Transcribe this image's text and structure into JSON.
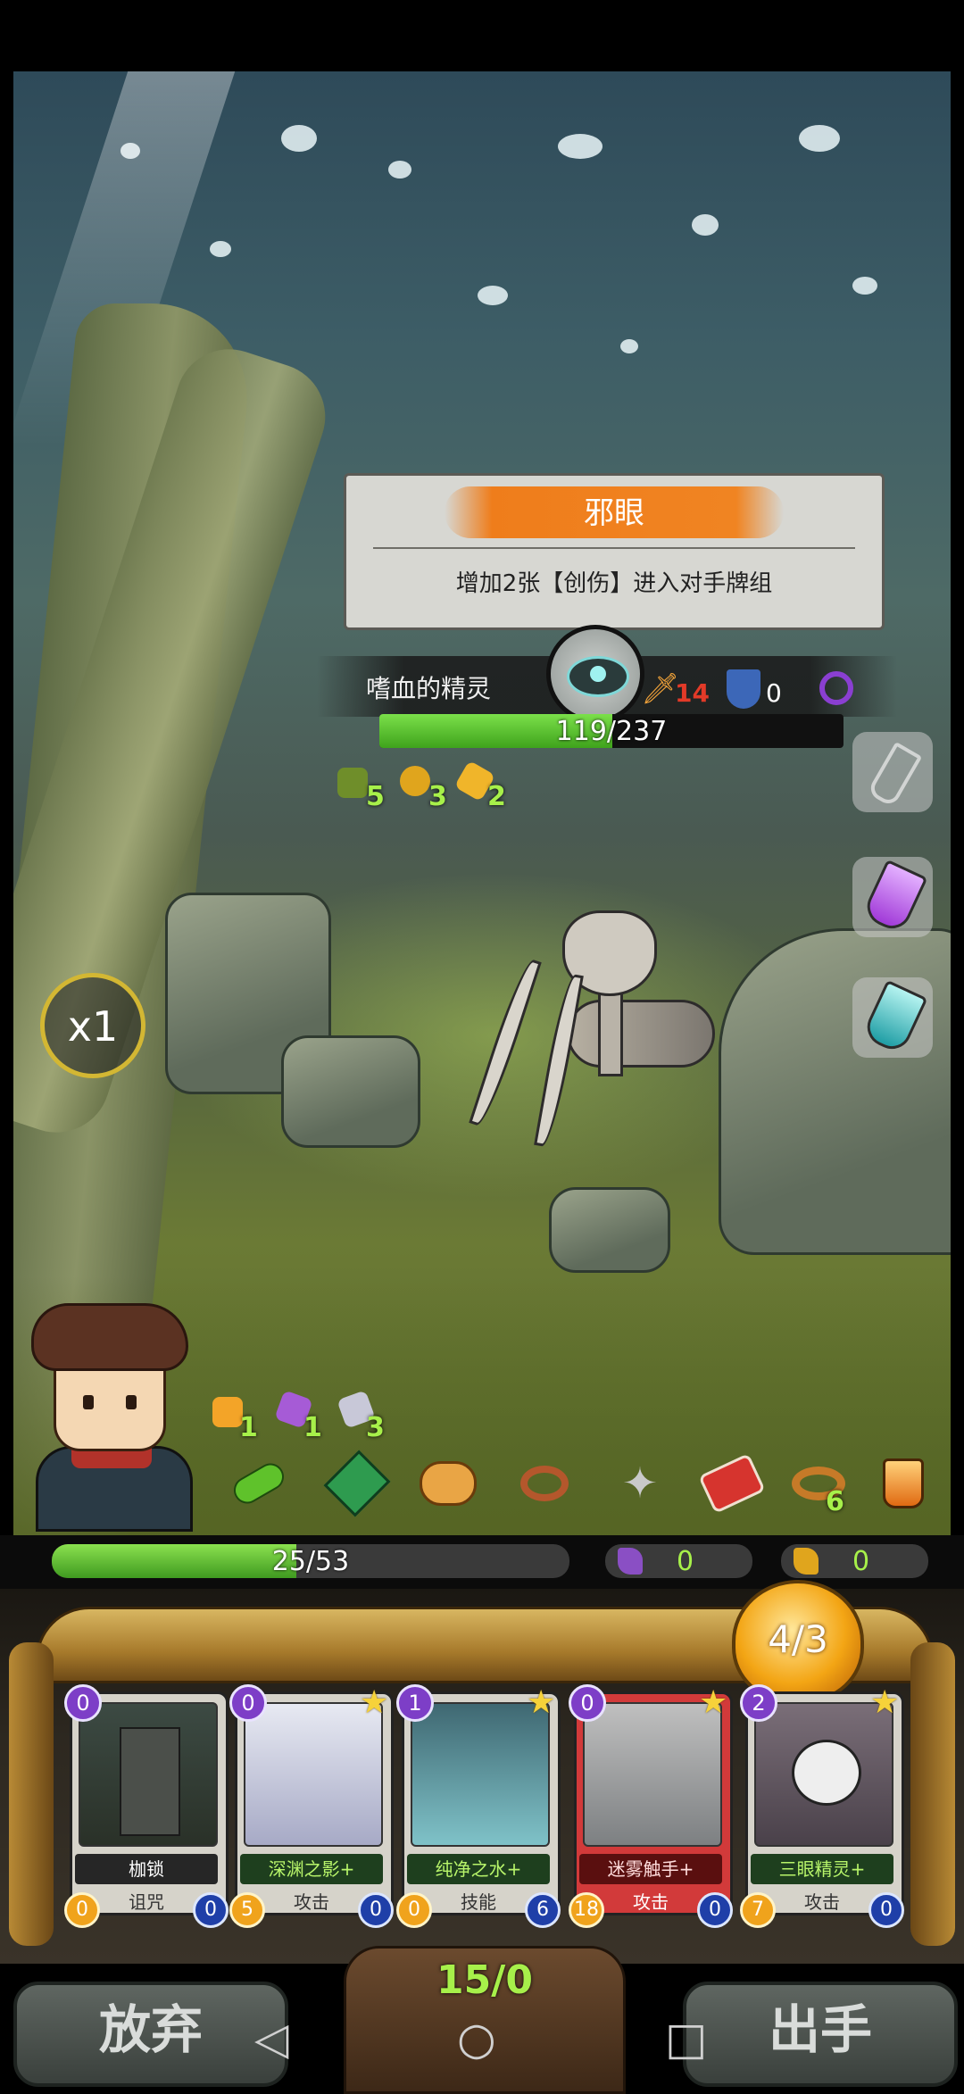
{
  "intent": {
    "title": "邪眼",
    "description": "增加2张【创伤】进入对手牌组"
  },
  "enemy": {
    "name": "嗜血的精灵",
    "attack": "14",
    "defense": "0",
    "hp_text": "119/237",
    "hp_fraction": 0.502,
    "buffs": [
      {
        "icon": "green-claw-icon",
        "value": "5"
      },
      {
        "icon": "yellow-swirl-icon",
        "value": "3"
      },
      {
        "icon": "fist-icon",
        "value": "2"
      }
    ]
  },
  "speed": "x1",
  "player": {
    "hp_text": "25/53",
    "hp_fraction": 0.472,
    "block": "0",
    "strength": "0",
    "buffs": [
      {
        "icon": "orange-fist-icon",
        "value": "1"
      },
      {
        "icon": "purple-crystal-icon",
        "value": "1"
      },
      {
        "icon": "silver-claw-icon",
        "value": "3"
      }
    ],
    "relic_counter": "6"
  },
  "energy": "4/3",
  "cards": [
    {
      "cost": "0",
      "name": "枷锁",
      "type": "诅咒",
      "left": "0",
      "right": "0",
      "star": false,
      "style": "gray"
    },
    {
      "cost": "0",
      "name": "深渊之影+",
      "type": "攻击",
      "left": "5",
      "right": "0",
      "star": true,
      "style": "green"
    },
    {
      "cost": "1",
      "name": "纯净之水+",
      "type": "技能",
      "left": "0",
      "right": "6",
      "star": true,
      "style": "green"
    },
    {
      "cost": "0",
      "name": "迷雾触手+",
      "type": "攻击",
      "left": "18",
      "right": "0",
      "star": true,
      "style": "red"
    },
    {
      "cost": "2",
      "name": "三眼精灵+",
      "type": "攻击",
      "left": "7",
      "right": "0",
      "star": true,
      "style": "green"
    }
  ],
  "deck_count": "15/0",
  "buttons": {
    "discard": "放弃",
    "play": "出手"
  },
  "nav": {
    "back": "◁",
    "home": "○",
    "recent": "□"
  }
}
